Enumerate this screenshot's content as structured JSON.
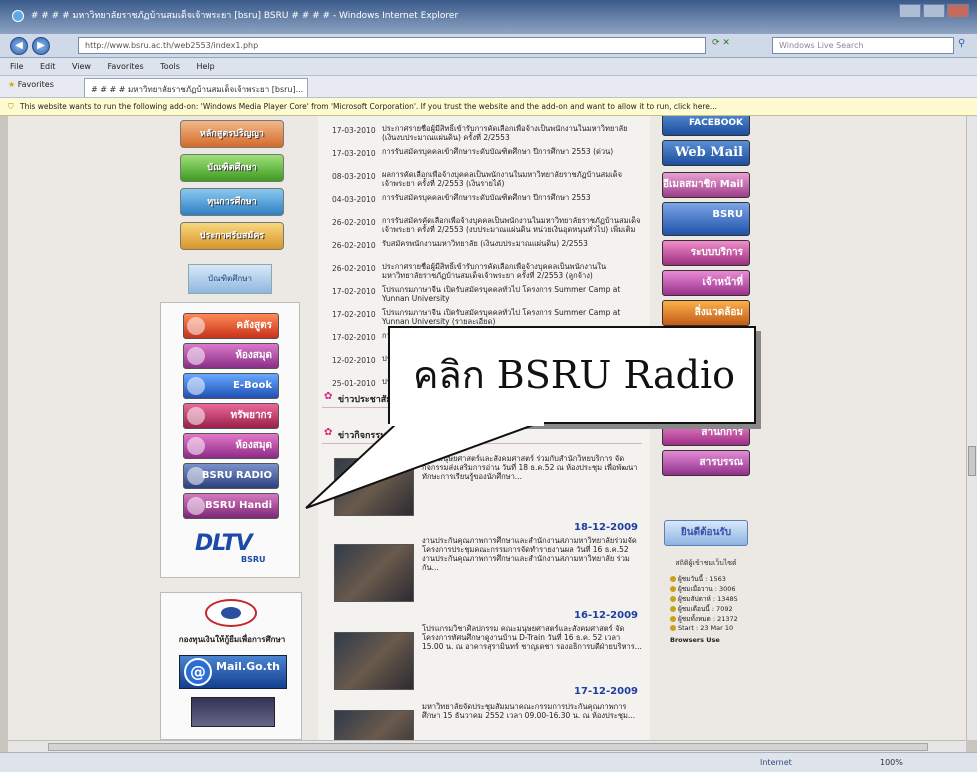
{
  "browser": {
    "title": "# # # # มหาวิทยาลัยราชภัฏบ้านสมเด็จเจ้าพระยา [bsru] BSRU # # # # - Windows Internet Explorer",
    "url": "http://www.bsru.ac.th/web2553/index1.php",
    "search_placeholder": "Windows Live Search",
    "menu": [
      "File",
      "Edit",
      "View",
      "Favorites",
      "Tools",
      "Help"
    ],
    "favorites_label": "Favorites",
    "tab_title": "# # # # มหาวิทยาลัยราชภัฏบ้านสมเด็จเจ้าพระยา [bsru]...",
    "infobar": "This website wants to run the following add-on: 'Windows Media Player Core' from 'Microsoft Corporation'. If you trust the website and the add-on and want to allow it to run, click here...",
    "status_zone": "Internet",
    "status_zoom": "100%"
  },
  "left": {
    "banners": [
      "หลักสูตรปริญญา",
      "บัณฑิตศึกษา",
      "ทุนการศึกษา",
      "ประกาศรับสมัคร"
    ],
    "small_banner": "บัณฑิตศึกษา",
    "menu_buttons": [
      "คลังสูตร",
      "ห้องสมุด",
      "E-Book",
      "ทรัพยากร",
      "ห้องสมุด",
      "BSRU RADIO",
      "BSRU Handi"
    ],
    "dltv": "DLTV",
    "dltv_sub": "BSRU",
    "ocsc_label": "กองทุนเงินให้กู้ยืมเพื่อการศึกษา",
    "mail_banner": "Mail.Go.th"
  },
  "news": [
    {
      "date": "17-03-2010",
      "text": "ประกาศรายชื่อผู้มีสิทธิ์เข้ารับการคัดเลือกเพื่อจ้างเป็นพนักงานในมหาวิทยาลัย (เงินงบประมาณแผ่นดิน) ครั้งที่ 2/2553"
    },
    {
      "date": "17-03-2010",
      "text": "การรับสมัครบุคคลเข้าศึกษาระดับบัณฑิตศึกษา ปีการศึกษา 2553 (ด่วน)"
    },
    {
      "date": "08-03-2010",
      "text": "ผลการคัดเลือกเพื่อจ้างบุคคลเป็นพนักงานในมหาวิทยาลัยราชภัฏบ้านสมเด็จเจ้าพระยา ครั้งที่ 2/2553 (เงินรายได้)"
    },
    {
      "date": "04-03-2010",
      "text": "การรับสมัครบุคคลเข้าศึกษาระดับบัณฑิตศึกษา ปีการศึกษา 2553"
    },
    {
      "date": "26-02-2010",
      "text": "การรับสมัครคัดเลือกเพื่อจ้างบุคคลเป็นพนักงานในมหาวิทยาลัยราชภัฏบ้านสมเด็จเจ้าพระยา ครั้งที่ 2/2553 (งบประมาณแผ่นดิน หน่วยเงินอุดหนุนทั่วไป) เพิ่มเติม"
    },
    {
      "date": "26-02-2010",
      "text": "รับสมัครพนักงานมหาวิทยาลัย (เงินงบประมาณแผ่นดิน) 2/2553"
    },
    {
      "date": "26-02-2010",
      "text": "ประกาศรายชื่อผู้มีสิทธิ์เข้ารับการคัดเลือกเพื่อจ้างบุคคลเป็นพนักงานในมหาวิทยาลัยราชภัฏบ้านสมเด็จเจ้าพระยา ครั้งที่ 2/2553 (ลูกจ้าง)"
    },
    {
      "date": "17-02-2010",
      "text": "โปรแกรมภาษาจีน เปิดรับสมัครบุคคลทั่วไป โครงการ Summer Camp at Yunnan University"
    },
    {
      "date": "17-02-2010",
      "text": "โปรแกรมภาษาจีน เปิดรับสมัครบุคคลทั่วไป โครงการ Summer Camp at Yunnan University (รายละเอียด)"
    },
    {
      "date": "17-02-2010",
      "text": "การรับสมัครบุคคลเพื่อบรรจุเข้ารับราชการ"
    },
    {
      "date": "12-02-2010",
      "text": "ประกาศผลการคัดเลือก"
    },
    {
      "date": "25-01-2010",
      "text": "ประกาศรับสมัคร"
    }
  ],
  "sections": {
    "news_heading": "ข่าวประชาสัมพันธ์",
    "activity_heading": "ข่าวกิจกรรม"
  },
  "activities": [
    {
      "date": "",
      "text": "คณะมนุษยศาสตร์และสังคมศาสตร์ ร่วมกับสำนักวิทยบริการ จัดกิจกรรมส่งเสริมการอ่าน วันที่ 18 ธ.ค.52 ณ ห้องประชุม เพื่อพัฒนาทักษะการเรียนรู้ของนักศึกษา..."
    },
    {
      "date": "18-12-2009",
      "text": "งานประกันคุณภาพการศึกษาและสำนักงานสภามหาวิทยาลัยร่วมจัดโครงการประชุมคณะกรรมการจัดทำรายงานผล วันที่ 16 ธ.ค.52 งานประกันคุณภาพการศึกษาและสำนักงานสภามหาวิทยาลัย ร่วมกัน..."
    },
    {
      "date": "16-12-2009",
      "text": "โปรแกรมวิชาศิลปกรรม คณะมนุษยศาสตร์และสังคมศาสตร์ จัดโครงการทัศนศึกษาดูงานบ้าน D-Train วันที่ 16 ธ.ค. 52 เวลา 15.00 น. ณ อาคารสุรามินทร์ ชาญเดชา รองอธิการบดีฝ่ายบริหาร..."
    },
    {
      "date": "17-12-2009",
      "text": "มหาวิทยาลัยจัดประชุมสัมมนาคณะกรรมการประกันคุณภาพการศึกษา 15 ธันวาคม 2552 เวลา 09.00-16.30 น. ณ ห้องประชุม..."
    }
  ],
  "right": {
    "buttons": [
      "FACEBOOK",
      "Web Mail",
      "อีเมลสมาชิก Mail",
      "BSRU",
      "ระบบบริการ",
      "เจ้าหน้าที่",
      "สิ่งแวดล้อม",
      "สำนักการ",
      "สารบรรณ"
    ],
    "welcome": "ยินดีต้อนรับ",
    "stats_title": "สถิติผู้เข้าชมเว็บไซต์",
    "stats": [
      "ผู้ชมวันนี้ : 1563",
      "ผู้ชมเมื่อวาน : 3006",
      "ผู้ชมสัปดาห์ : 13485",
      "ผู้ชมเดือนนี้ : 7092",
      "ผู้ชมทั้งหมด : 21372",
      "Start : 23 Mar 10"
    ],
    "browsers": "Browsers Use"
  },
  "callout": {
    "text": "คลิก BSRU Radio"
  },
  "colors": {
    "titlebar": "#3a5a8a",
    "infobar": "#fffbd1",
    "activity_date": "#1d3fa5"
  }
}
